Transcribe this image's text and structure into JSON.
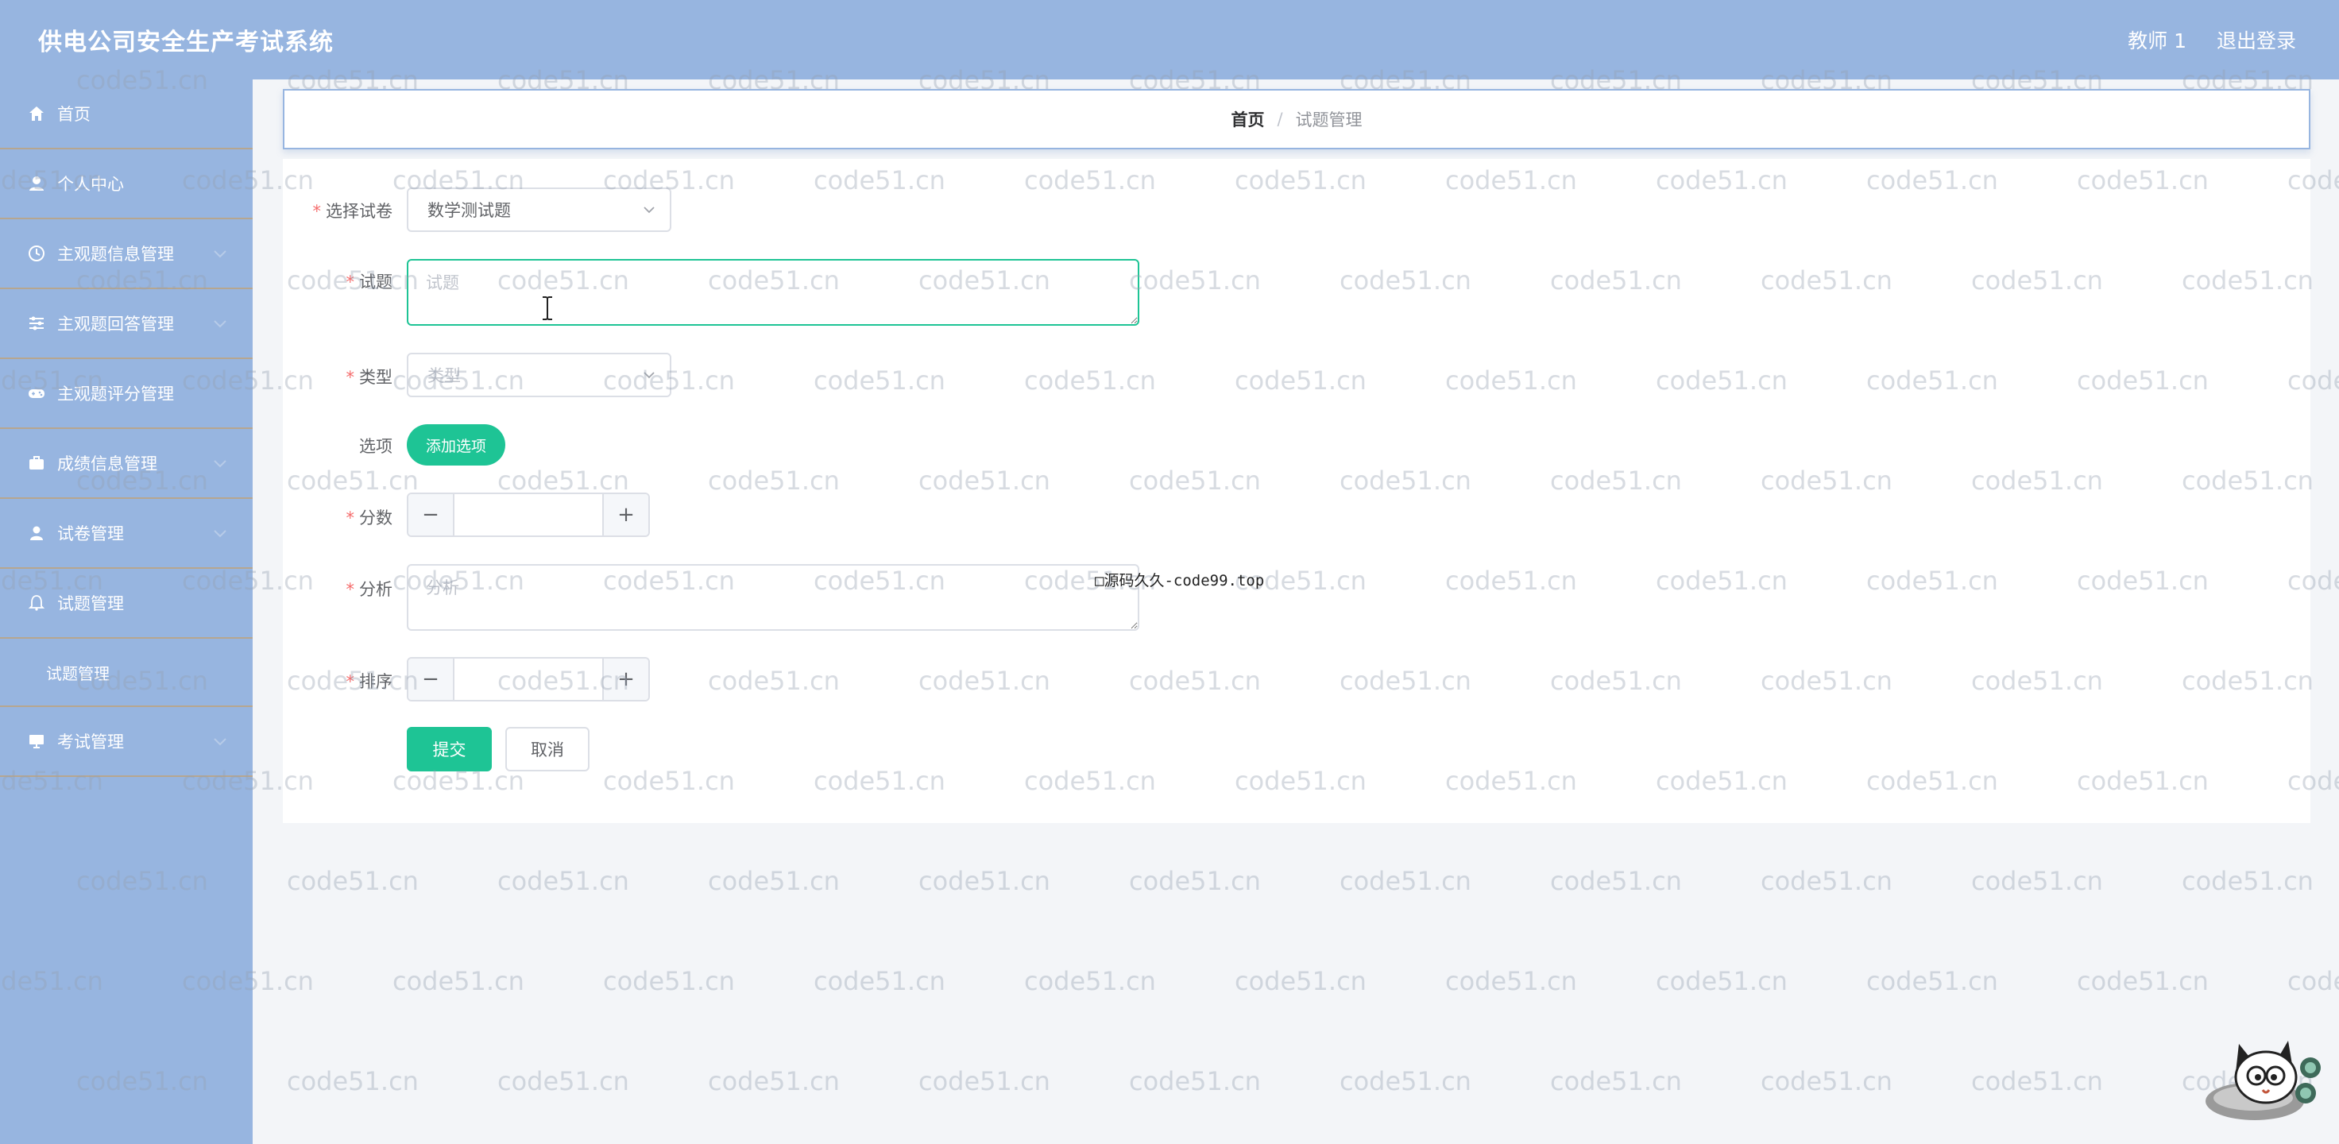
{
  "header": {
    "title": "供电公司安全生产考试系统",
    "user": "教师 1",
    "logout": "退出登录"
  },
  "sidebar": {
    "items": [
      {
        "label": "首页",
        "icon": "home-icon"
      },
      {
        "label": "个人中心",
        "icon": "user-center-icon"
      },
      {
        "label": "主观题信息管理",
        "icon": "clock-icon"
      },
      {
        "label": "主观题回答管理",
        "icon": "sliders-icon"
      },
      {
        "label": "主观题评分管理",
        "icon": "gamepad-icon"
      },
      {
        "label": "成绩信息管理",
        "icon": "briefcase-icon"
      },
      {
        "label": "试卷管理",
        "icon": "person-icon"
      },
      {
        "label": "试题管理",
        "icon": "bell-icon"
      },
      {
        "label": "考试管理",
        "icon": "monitor-icon"
      }
    ],
    "submenu_label": "试题管理"
  },
  "breadcrumb": {
    "home": "首页",
    "separator": "/",
    "current": "试题管理"
  },
  "form": {
    "paper": {
      "label": "选择试卷",
      "value": "数学测试题"
    },
    "question": {
      "label": "试题",
      "placeholder": "试题",
      "value": ""
    },
    "type": {
      "label": "类型",
      "placeholder": "类型"
    },
    "options": {
      "label": "选项",
      "button": "添加选项"
    },
    "score": {
      "label": "分数",
      "minus": "−",
      "plus": "+",
      "value": ""
    },
    "analysis": {
      "label": "分析",
      "placeholder": "分析",
      "value": ""
    },
    "order": {
      "label": "排序",
      "minus": "−",
      "plus": "+",
      "value": ""
    },
    "submit": "提交",
    "cancel": "取消"
  },
  "watermark": {
    "tile_text": "code51.cn",
    "overlay_text": "□源码久久-code99.top"
  },
  "colors": {
    "primary_blue": "#97b5e0",
    "accent_green": "#1ec495",
    "required_red": "#f56c6c",
    "sidebar_divider": "#b6a690"
  }
}
